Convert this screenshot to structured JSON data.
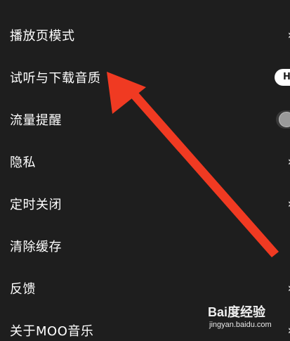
{
  "menu": {
    "items": [
      {
        "label": "播放页模式",
        "trailing": "chevron"
      },
      {
        "label": "试听与下载音质",
        "trailing": "quality",
        "value": "H"
      },
      {
        "label": "流量提醒",
        "trailing": "toggle",
        "toggle_on": false
      },
      {
        "label": "隐私",
        "trailing": "chevron"
      },
      {
        "label": "定时关闭",
        "trailing": "chevron"
      },
      {
        "label": "清除缓存",
        "trailing": "none"
      },
      {
        "label": "反馈",
        "trailing": "chevron"
      },
      {
        "label": "关于MOO音乐",
        "trailing": "chevron"
      }
    ],
    "chevron_glyph": "›"
  },
  "annotation": {
    "arrow_color": "#f03a22",
    "points_to": "试听与下载音质"
  },
  "watermark": {
    "logo": "Bai度经验",
    "url": "jingyan.baidu.com"
  },
  "colors": {
    "background": "#1e1e1e",
    "text": "#ffffff"
  }
}
